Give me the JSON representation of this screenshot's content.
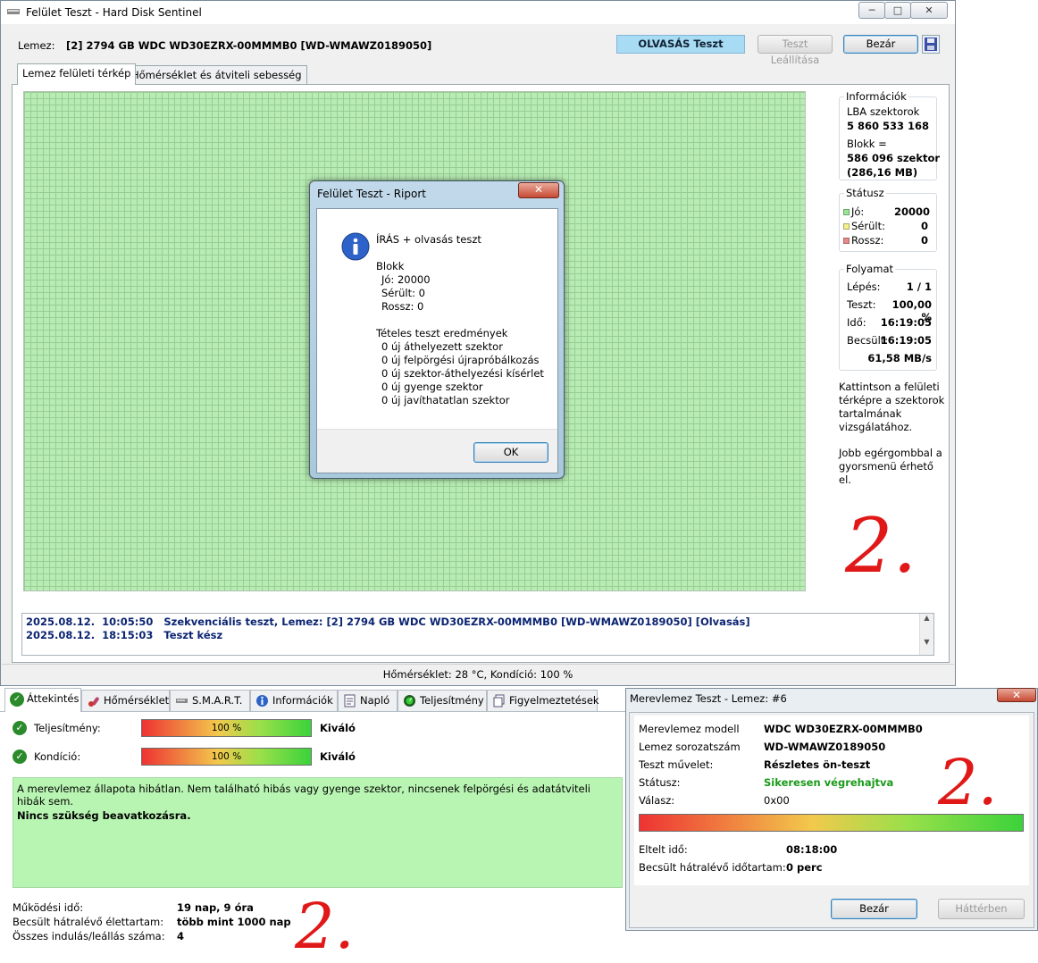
{
  "main": {
    "title": "Felület Teszt - Hard Disk Sentinel",
    "disk_label": "Lemez:",
    "disk_value": "[2] 2794 GB  WDC WD30EZRX-00MMMB0 [WD-WMAWZ0189050]",
    "mode_badge": "OLVASÁS Teszt",
    "stop_button": "Teszt Leállítása",
    "close_button": "Bezár",
    "tabs": [
      "Lemez felületi térkép",
      "Hőmérséklet és átviteli sebesség"
    ],
    "info": {
      "title": "Információk",
      "lba_label": "LBA szektorok",
      "lba_value": "5 860 533 168",
      "block_label": "Blokk =",
      "block_value": "586 096 szektor",
      "block_size": "(286,16 MB)"
    },
    "status": {
      "title": "Státusz",
      "good_label": "Jó:",
      "good_value": "20000",
      "damaged_label": "Sérült:",
      "damaged_value": "0",
      "bad_label": "Rossz:",
      "bad_value": "0",
      "good_color": "#9be39b",
      "damaged_color": "#f5f08a",
      "bad_color": "#e98a8a"
    },
    "progress": {
      "title": "Folyamat",
      "step_label": "Lépés:",
      "step_value": "1 / 1",
      "test_label": "Teszt:",
      "test_value": "100,00 %",
      "time_label": "Idő:",
      "time_value": "16:19:05",
      "est_label": "Becsült:",
      "est_value": "16:19:05",
      "speed": "61,58 MB/s"
    },
    "hint1": [
      "Kattintson a felületi",
      "térképre a szektorok",
      "tartalmának",
      "vizsgálatához."
    ],
    "hint2": [
      "Jobb egérgombbal a",
      "gyorsmenü érhető",
      "el."
    ],
    "log": [
      {
        "date": "2025.08.12.",
        "time": "10:05:50",
        "text": "Szekvenciális teszt, Lemez: [2] 2794 GB  WDC WD30EZRX-00MMMB0 [WD-WMAWZ0189050] [Olvasás]"
      },
      {
        "date": "2025.08.12.",
        "time": "18:15:03",
        "text": "Teszt kész"
      }
    ],
    "statusbar": "Hőmérséklet: 28  °C,  Kondíció: 100 %"
  },
  "dialog": {
    "title": "Felület Teszt - Riport",
    "heading": "ÍRÁS + olvasás teszt",
    "block_title": "Blokk",
    "block_lines": [
      "Jó: 20000",
      "Sérült: 0",
      "Rossz: 0"
    ],
    "results_title": "Tételes teszt eredmények",
    "results_lines": [
      "0 új áthelyezett szektor",
      "0 új felpörgési újrapróbálkozás",
      "0 új szektor-áthelyezési kísérlet",
      "0 új gyenge szektor",
      "0 új javíthatatlan szektor"
    ],
    "ok": "OK"
  },
  "overview": {
    "tabs": [
      "Áttekintés",
      "Hőmérséklet",
      "S.M.A.R.T.",
      "Információk",
      "Napló",
      "Teljesítmény",
      "Figyelmeztetések"
    ],
    "performance_label": "Teljesítmény:",
    "performance_value": "100 %",
    "performance_rating": "Kiváló",
    "condition_label": "Kondíció:",
    "condition_value": "100 %",
    "condition_rating": "Kiváló",
    "message": "A merevlemez állapota hibátlan. Nem található hibás vagy gyenge szektor, nincsenek felpörgési és adatátviteli hibák sem.",
    "message_bold": "Nincs szükség beavatkozásra.",
    "uptime_label": "Működési idő:",
    "uptime_value": "19 nap, 9 óra",
    "life_label": "Becsült hátralévő élettartam:",
    "life_value": "több mint 1000 nap",
    "starts_label": "Összes indulás/leállás száma:",
    "starts_value": "4"
  },
  "disktest": {
    "title": "Merevlemez Teszt - Lemez: #6",
    "model_label": "Merevlemez modell",
    "model_value": "WDC WD30EZRX-00MMMB0",
    "serial_label": "Lemez sorozatszám",
    "serial_value": "WD-WMAWZ0189050",
    "op_label": "Teszt művelet:",
    "op_value": "Részletes ön-teszt",
    "status_label": "Státusz:",
    "status_value": "Sikeresen végrehajtva",
    "reply_label": "Válasz:",
    "reply_value": "0x00",
    "progress": 1.0,
    "elapsed_label": "Eltelt idő:",
    "elapsed_value": "08:18:00",
    "remaining_label": "Becsült hátralévő időtartam:",
    "remaining_value": "0 perc",
    "close_button": "Bezár",
    "background_button": "Háttérben"
  },
  "annotation": "2."
}
